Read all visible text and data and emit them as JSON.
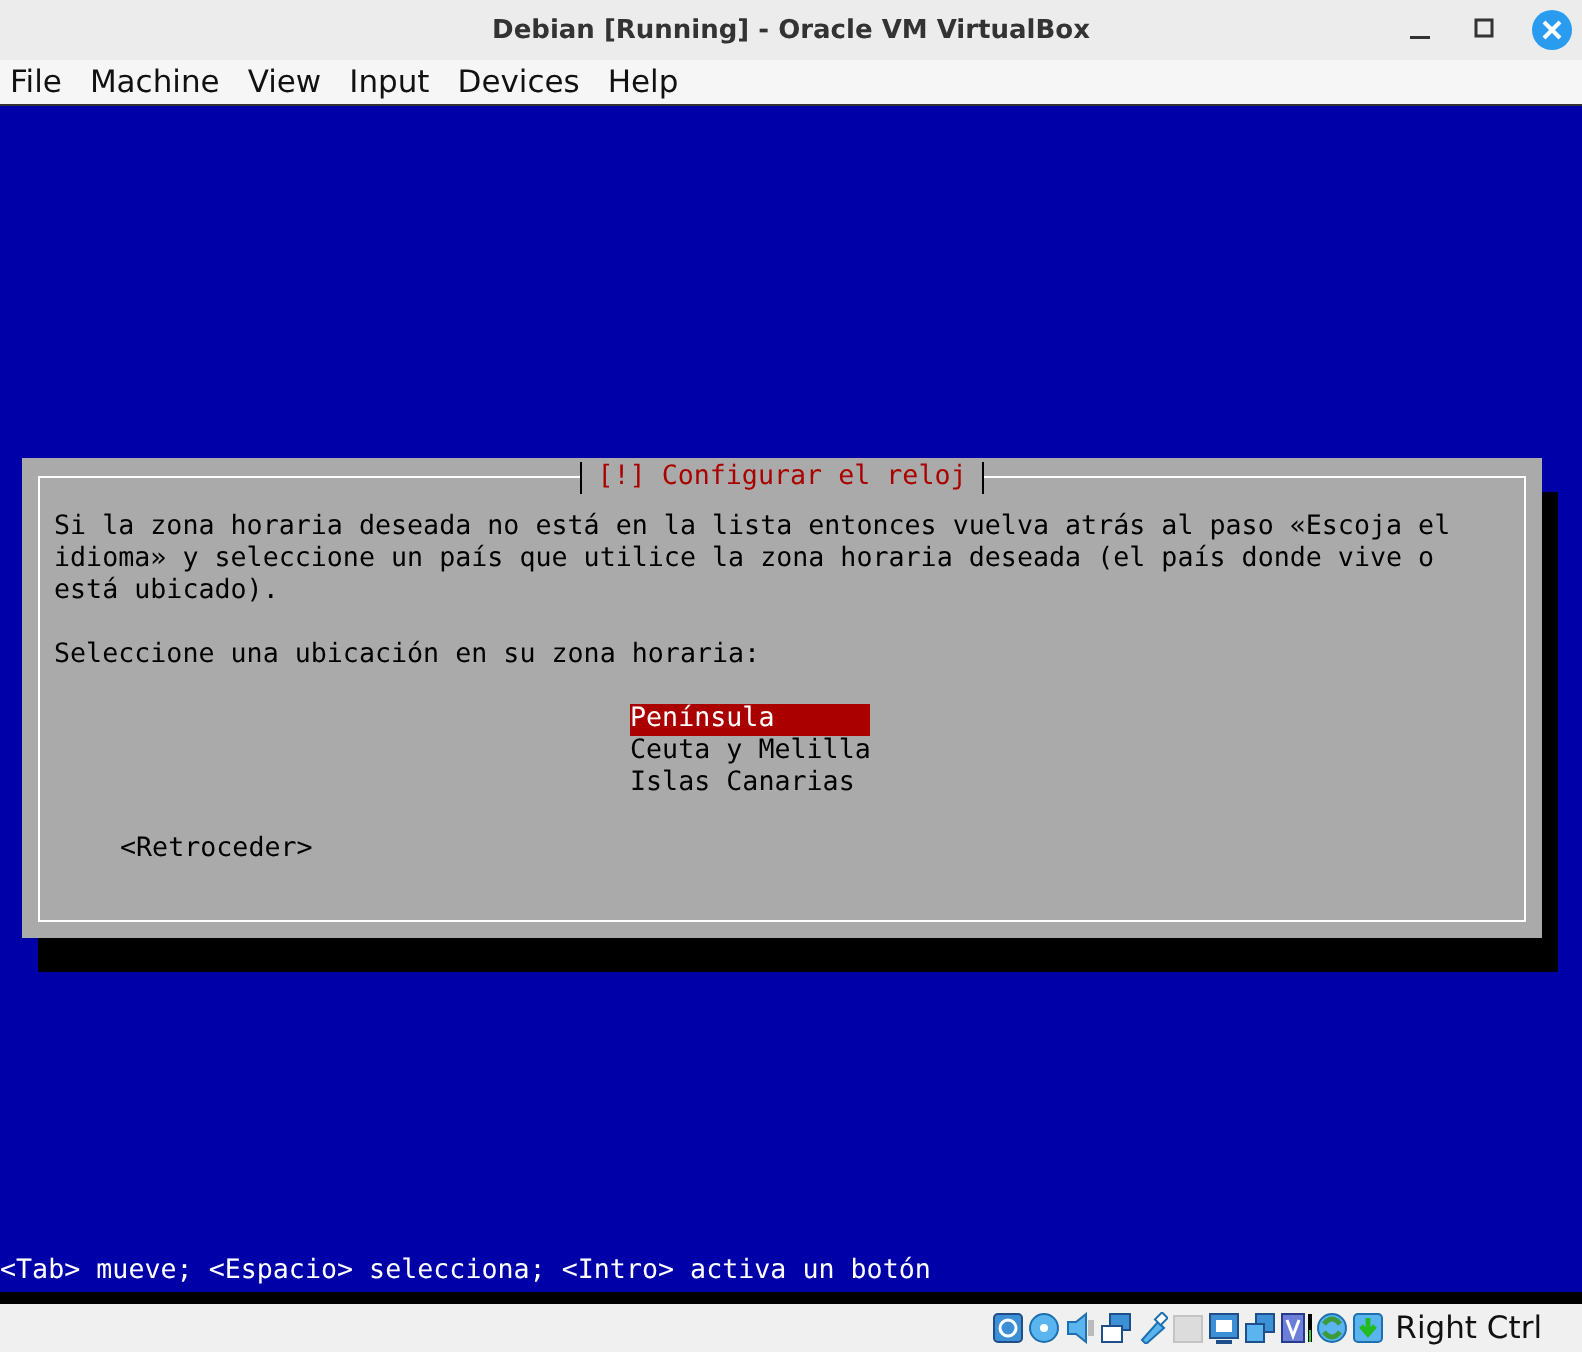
{
  "window": {
    "title": "Debian [Running] - Oracle VM VirtualBox"
  },
  "menu": [
    "File",
    "Machine",
    "View",
    "Input",
    "Devices",
    "Help"
  ],
  "dialog": {
    "title": "[!] Configurar el reloj",
    "message": "Si la zona horaria deseada no está en la lista entonces vuelva atrás al paso «Escoja el idioma» y seleccione un país que utilice la zona horaria deseada (el país donde vive o está ubicado).",
    "prompt": "Seleccione una ubicación en su zona horaria:",
    "options": [
      {
        "label": "Península",
        "selected": true
      },
      {
        "label": "Ceuta y Melilla",
        "selected": false
      },
      {
        "label": "Islas Canarias",
        "selected": false
      }
    ],
    "buttons": [
      "<Retroceder>"
    ]
  },
  "help_line": "<Tab> mueve; <Espacio> selecciona; <Intro> activa un botón",
  "status_bar": {
    "host_key": "Right Ctrl"
  }
}
